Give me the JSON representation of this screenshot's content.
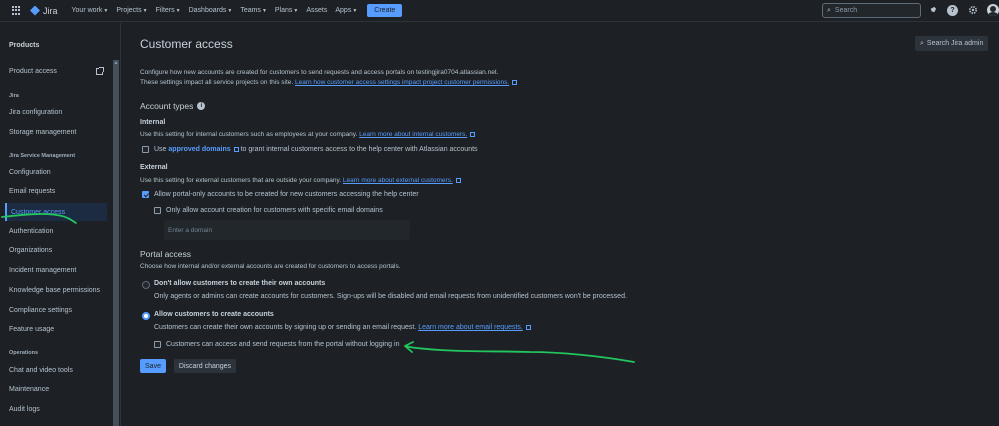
{
  "topnav": {
    "app_name": "Jira",
    "items": [
      "Your work",
      "Projects",
      "Filters",
      "Dashboards",
      "Teams",
      "Plans",
      "Assets",
      "Apps"
    ],
    "create_label": "Create",
    "search_placeholder": "Search",
    "help_glyph": "?"
  },
  "sidebar": {
    "heading": "Products",
    "product_access": "Product access",
    "section_jira": "Jira",
    "jira_items": [
      "Jira configuration",
      "Storage management"
    ],
    "section_jsm": "Jira Service Management",
    "jsm_items": [
      "Configuration",
      "Email requests",
      "Customer access",
      "Authentication",
      "Organizations",
      "Incident management",
      "Knowledge base permissions",
      "Compliance settings",
      "Feature usage"
    ],
    "section_ops": "Operations",
    "ops_items": [
      "Chat and video tools",
      "Maintenance",
      "Audit logs"
    ]
  },
  "main": {
    "title": "Customer access",
    "search_admin_label": "Search Jira admin",
    "intro_line1": "Configure how new accounts are created for customers to send requests and access portals on testingjira0704.atlassian.net.",
    "intro_line2_text": "These settings impact all service projects on this site. ",
    "intro_line2_link": "Learn how customer access settings impact project customer permissions.",
    "account_types": {
      "heading": "Account types",
      "info_glyph": "i",
      "internal": {
        "title": "Internal",
        "desc_text": "Use this setting for internal customers such as employees at your company. ",
        "desc_link": "Learn more about internal customers.",
        "check_prefix": "Use ",
        "check_link": "approved domains",
        "check_suffix": " to grant internal customers access to the help center with Atlassian accounts"
      },
      "external": {
        "title": "External",
        "desc_text": "Use this setting for external customers that are outside your company. ",
        "desc_link": "Learn more about external customers.",
        "check1": "Allow portal-only accounts to be created for new customers accessing the help center",
        "check2": "Only allow account creation for customers with specific email domains",
        "domain_placeholder": "Enter a domain"
      }
    },
    "portal_access": {
      "heading": "Portal access",
      "desc": "Choose how internal and/or external accounts are created for customers to access portals.",
      "option1_title": "Don't allow customers to create their own accounts",
      "option1_desc": "Only agents or admins can create accounts for customers. Sign-ups will be disabled and email requests from unidentified customers won't be processed.",
      "option2_title": "Allow customers to create accounts",
      "option2_desc_text": "Customers can create their own accounts by signing up or sending an email request. ",
      "option2_desc_link": "Learn more about email requests.",
      "anonymous_check": "Customers can access and send requests from the portal without logging in"
    },
    "save_label": "Save",
    "discard_label": "Discard changes"
  },
  "colors": {
    "accent": "#579dff",
    "annotation": "#22c55e",
    "background": "#1d2125"
  }
}
